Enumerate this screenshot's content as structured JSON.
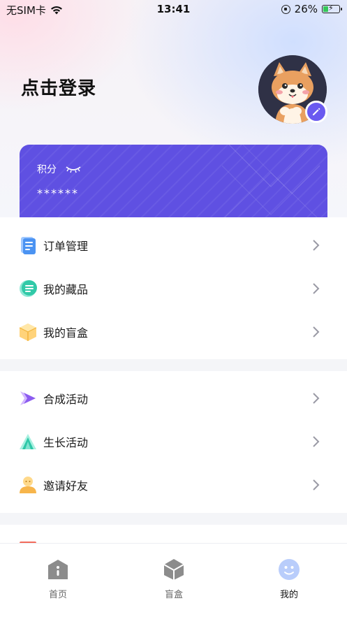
{
  "status_bar": {
    "carrier": "无SIM卡",
    "time": "13:41",
    "battery": "26%",
    "battery_level": 0.26
  },
  "profile": {
    "login_label": "点击登录"
  },
  "points": {
    "label": "积分",
    "value": "******"
  },
  "menu_group_1": [
    {
      "label": "订单管理",
      "icon": "order-icon"
    },
    {
      "label": "我的藏品",
      "icon": "collection-icon"
    },
    {
      "label": "我的盲盒",
      "icon": "blindbox-icon"
    }
  ],
  "menu_group_2": [
    {
      "label": "合成活动",
      "icon": "synthesis-icon"
    },
    {
      "label": "生长活动",
      "icon": "growth-icon"
    },
    {
      "label": "邀请好友",
      "icon": "invite-icon"
    }
  ],
  "tab_bar": [
    {
      "label": "首页",
      "icon": "home-icon"
    },
    {
      "label": "盲盒",
      "icon": "box-icon"
    },
    {
      "label": "我的",
      "icon": "profile-icon",
      "active": true
    }
  ],
  "colors": {
    "accent": "#5f50e2",
    "edit_badge": "#6a5af0"
  }
}
